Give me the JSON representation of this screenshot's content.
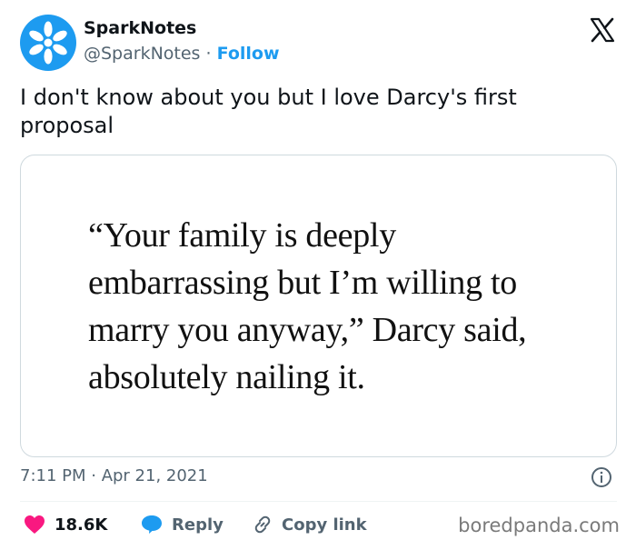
{
  "author": {
    "name": "SparkNotes",
    "handle": "@SparkNotes",
    "separator": "·",
    "follow_label": "Follow",
    "avatar_color": "#1d9bf0"
  },
  "platform_icon": "x-logo-icon",
  "tweet_text": "I don't know about you but I love Darcy's first proposal",
  "media": {
    "quote_text": "“Your family is deeply embarrassing but I’m willing to marry you anyway,” Darcy said, absolutely nailing it."
  },
  "timestamp": "7:11 PM · Apr 21, 2021",
  "actions": {
    "likes": "18.6K",
    "reply_label": "Reply",
    "copy_link_label": "Copy link"
  },
  "colors": {
    "like": "#f91880",
    "reply": "#1d9bf0",
    "follow": "#1d9bf0",
    "muted": "#536471"
  },
  "watermark": "boredpanda.com"
}
